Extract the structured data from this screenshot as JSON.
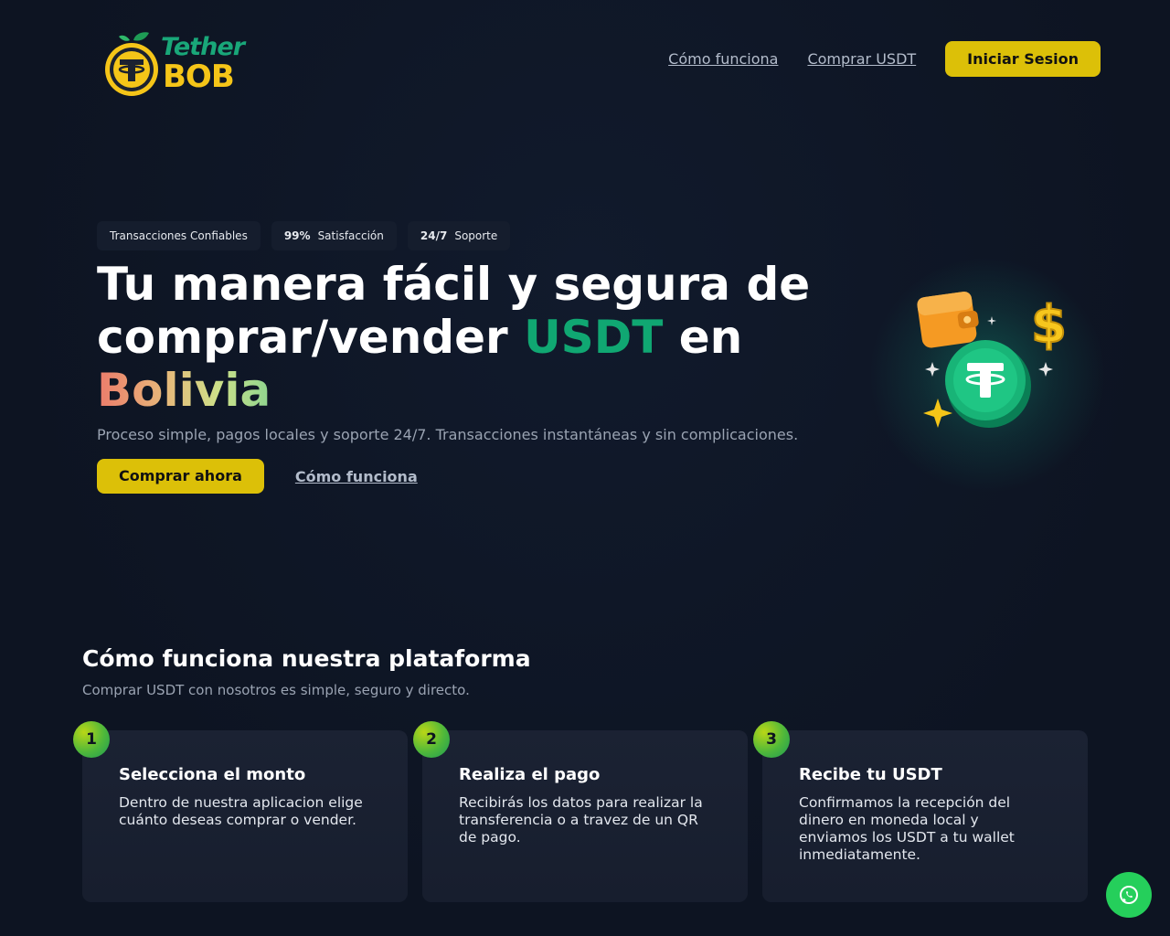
{
  "brand": {
    "line1": "Tether",
    "line2": "BOB"
  },
  "nav": {
    "links": [
      "Cómo funciona",
      "Comprar USDT"
    ],
    "login_label": "Iniciar Sesion"
  },
  "hero": {
    "badges": [
      {
        "strong": "",
        "text": "Transacciones Confiables"
      },
      {
        "strong": "99%",
        "text": "Satisfacción"
      },
      {
        "strong": "24/7",
        "text": "Soporte"
      }
    ],
    "title_part1": "Tu manera fácil y segura de comprar/vender ",
    "title_usdt": "USDT",
    "title_part2": " en ",
    "title_bolivia": "Bolivia",
    "subtitle": "Proceso simple, pagos locales y soporte 24/7. Transacciones instantáneas y sin complicaciones.",
    "primary_cta": "Comprar ahora",
    "secondary_cta": "Cómo funciona"
  },
  "how": {
    "title": "Cómo funciona nuestra plataforma",
    "subtitle": "Comprar USDT con nosotros es simple, seguro y directo.",
    "steps": [
      {
        "number": "1",
        "title": "Selecciona el monto",
        "text": "Dentro de nuestra aplicacion elige cuánto deseas comprar o vender."
      },
      {
        "number": "2",
        "title": "Realiza el pago",
        "text": "Recibirás los datos para realizar la transferencia o a travez de un QR de pago."
      },
      {
        "number": "3",
        "title": "Recibe tu USDT",
        "text": "Confirmamos la recepción del dinero en moneda local y enviamos los USDT a tu wallet inmediatamente."
      }
    ]
  },
  "icons": {
    "logo": "tether-coin-with-leaves-icon",
    "hero": "wallet-tether-coin-dollar-icon",
    "fab": "whatsapp-icon"
  },
  "colors": {
    "background": "#0f1626",
    "accent_yellow": "#dcc008",
    "accent_green": "#10a772",
    "whatsapp": "#25cf5b"
  }
}
